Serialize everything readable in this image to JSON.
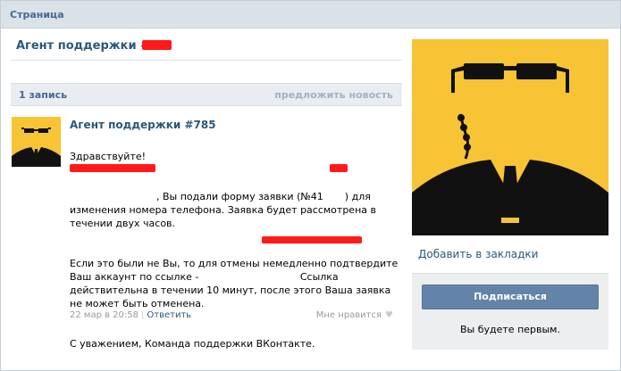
{
  "header": {
    "title": "Страница"
  },
  "page": {
    "name": "Агент поддержки #"
  },
  "wall": {
    "count_label": "1 запись",
    "suggest_label": "предложить новость"
  },
  "post": {
    "author": "Агент поддержки #785",
    "greeting": "Здравствуйте!",
    "p1_a": ", Вы подали форму заявки (№41",
    "p1_b": ") для изменения номера телефона. Заявка будет рассмотрена в течении двух часов.",
    "p2_a": "Если это были не Вы, то для отмены немедленно подтвердите Ваш аккаунт по ссылке -",
    "p2_b": "Ссылка действительна в течении 10 минут, после этого Ваша заявка не может быть отменена.",
    "p3": "С уважением, Команда поддержки ВКонтакте.",
    "date": "22 мар в 20:58",
    "reply_label": "Ответить",
    "like_label": "Мне нравится"
  },
  "sidebar": {
    "bookmark_label": "Добавить в закладки",
    "subscribe_label": "Подписаться",
    "note": "Вы будете первым."
  },
  "colors": {
    "accent": "#2b587a",
    "header_bg": "#dae2e8",
    "avatar_bg": "#f7c435",
    "button_bg": "#6383a8",
    "redaction": "#ff1a1a"
  }
}
